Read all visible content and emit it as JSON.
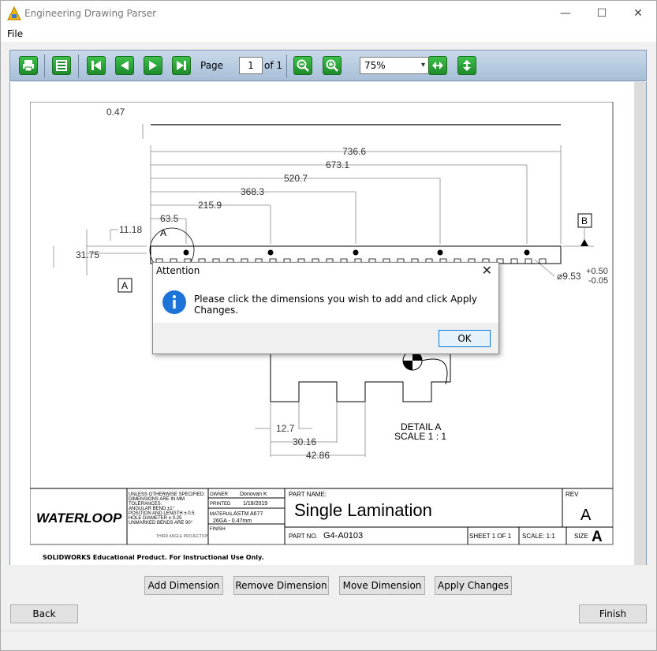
{
  "window": {
    "title": "Engineering Drawing Parser",
    "minimize": "—",
    "maximize": "☐",
    "close": "✕"
  },
  "menu": {
    "file": "File"
  },
  "toolbar": {
    "page_label": "Page",
    "page_value": "1",
    "of_label": "of 1",
    "zoom_value": "75%"
  },
  "drawing": {
    "dims": {
      "d047": "0.47",
      "d7366": "736.6",
      "d6731": "673.1",
      "d5207": "520.7",
      "d3683": "368.3",
      "d2159": "215.9",
      "d635": "63.5",
      "d1118": "11.18",
      "d3175": "31.75",
      "d953": "⌀9.53",
      "tol_plus": "+0.50",
      "tol_minus": "-0.05",
      "d127": "12.7",
      "d3016": "30.16",
      "d4286": "42.86"
    },
    "datum_a": "A",
    "datum_b": "B",
    "detail_a_label": "A",
    "detail_title": "DETAIL A",
    "detail_scale": "SCALE 1 : 1",
    "title_block": {
      "logo": "WATERLOOP",
      "notes": [
        "UNLESS OTHERWISE SPECIFIED:",
        "DIMENSIONS ARE IN MM",
        "TOLERANCES:",
        "ANGULAR BEND ±1°",
        "POSITION AND LENGTH ± 0.5",
        "HOLE DIAMETER ± 0.25",
        "UNMARKED BENDS ARE 90°"
      ],
      "projection": "THIRD ANGLE PROJECTION",
      "owner_label": "OWNER",
      "owner": "Donovan K",
      "printed_label": "PRINTED",
      "printed": "1/18/2019",
      "material_label": "MATERIAL",
      "material": "ASTM A677",
      "material2": "26GA - 0.47mm",
      "finish_label": "FINISH",
      "part_name_label": "PART NAME:",
      "part_name": "Single Lamination",
      "part_no_label": "PART NO.",
      "part_no": "G4-A0103",
      "sheet": "SHEET 1 OF 1",
      "scale": "SCALE: 1:1",
      "size_label": "SIZE",
      "size": "A",
      "rev_label": "REV",
      "rev": "A"
    },
    "footer_note": "SOLIDWORKS Educational Product. For Instructional Use Only."
  },
  "buttons": {
    "add_dimension": "Add Dimension",
    "remove_dimension": "Remove Dimension",
    "move_dimension": "Move Dimension",
    "apply_changes": "Apply Changes",
    "back": "Back",
    "finish": "Finish"
  },
  "dialog": {
    "title": "Attention",
    "message": "Please click the dimensions you wish to add and click Apply Changes.",
    "ok": "OK",
    "close": "✕"
  },
  "colors": {
    "toolbar_button": "#2ea83a",
    "info_icon": "#1e73d8"
  }
}
